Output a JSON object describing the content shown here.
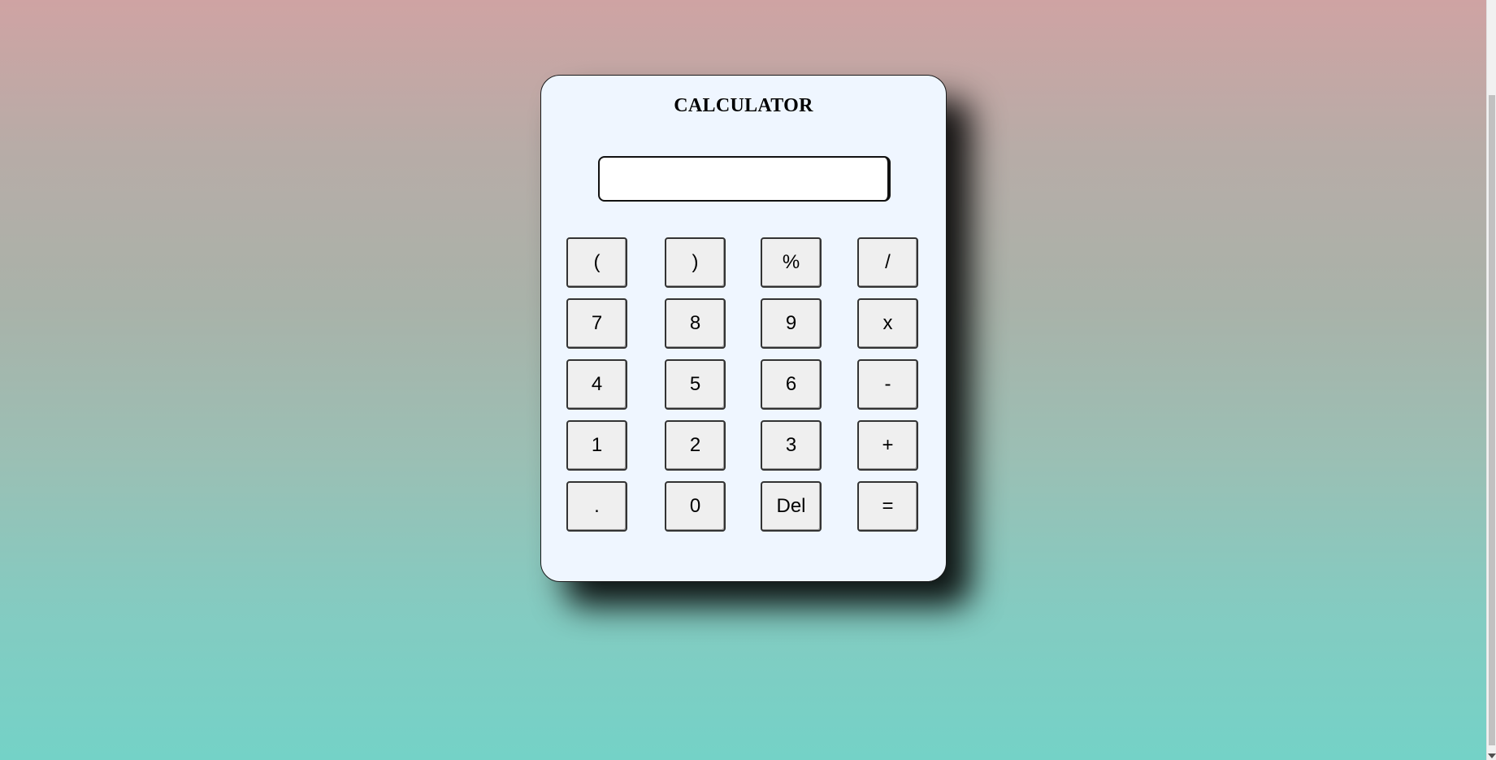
{
  "calculator": {
    "title": "CALCULATOR",
    "display_value": "",
    "keys": [
      [
        "(",
        ")",
        "%",
        "/"
      ],
      [
        "7",
        "8",
        "9",
        "x"
      ],
      [
        "4",
        "5",
        "6",
        "-"
      ],
      [
        "1",
        "2",
        "3",
        "+"
      ],
      [
        ".",
        "0",
        "Del",
        "="
      ]
    ]
  },
  "colors": {
    "background_top": "#cfa3a3",
    "background_bottom": "#74d2c7",
    "panel": "#eff6ff",
    "key": "#efefef"
  }
}
